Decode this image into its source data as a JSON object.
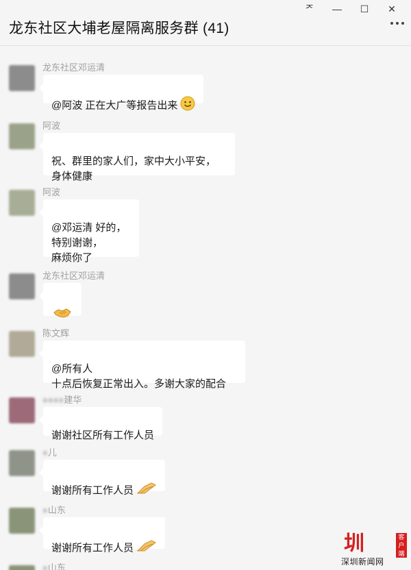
{
  "window": {
    "controls": [
      "ᅎ",
      "—",
      "☐",
      "✕"
    ]
  },
  "header": {
    "title": "龙东社区大埔老屋隔离服务群 (41)",
    "more_icon": "more-dots-icon"
  },
  "messages": [
    {
      "sender": "龙东社区邓运清",
      "text": "@阿波 正在大广等报告出来",
      "emoji": "smile-emoji",
      "avatar_color": "#8c8c8c"
    },
    {
      "sender": "阿波",
      "text": "祝、群里的家人们，家中大小平安，\n身体健康",
      "emoji": "",
      "avatar_color": "#9aa38a"
    },
    {
      "sender": "阿波",
      "text": "@邓运清 好的，\n特别谢谢，\n麻烦你了",
      "emoji": "",
      "avatar_color": "#a7ad96"
    },
    {
      "sender": "龙东社区邓运清",
      "text": "",
      "emoji": "handshake-emoji",
      "avatar_color": "#8c8c8c"
    },
    {
      "sender": "陈文辉",
      "text": "@所有人\n十点后恢复正常出入。多谢大家的配合",
      "emoji": "",
      "avatar_color": "#b2aa98"
    },
    {
      "sender": "建华",
      "text": "谢谢社区所有工作人员",
      "emoji": "",
      "avatar_color": "#9c6a78"
    },
    {
      "sender": "儿",
      "text": "谢谢所有工作人员",
      "emoji": "clap-hands-emoji",
      "avatar_color": "#8f948a"
    },
    {
      "sender": "山东",
      "text": "谢谢所有工作人员",
      "emoji": "clap-hands-emoji",
      "avatar_color": "#8a9478"
    },
    {
      "sender": "山东",
      "text": "",
      "emoji": "",
      "avatar_color": "#8a9478"
    }
  ],
  "watermark": {
    "logo": "圳",
    "side": "客户端",
    "text": "深圳新闻网"
  }
}
